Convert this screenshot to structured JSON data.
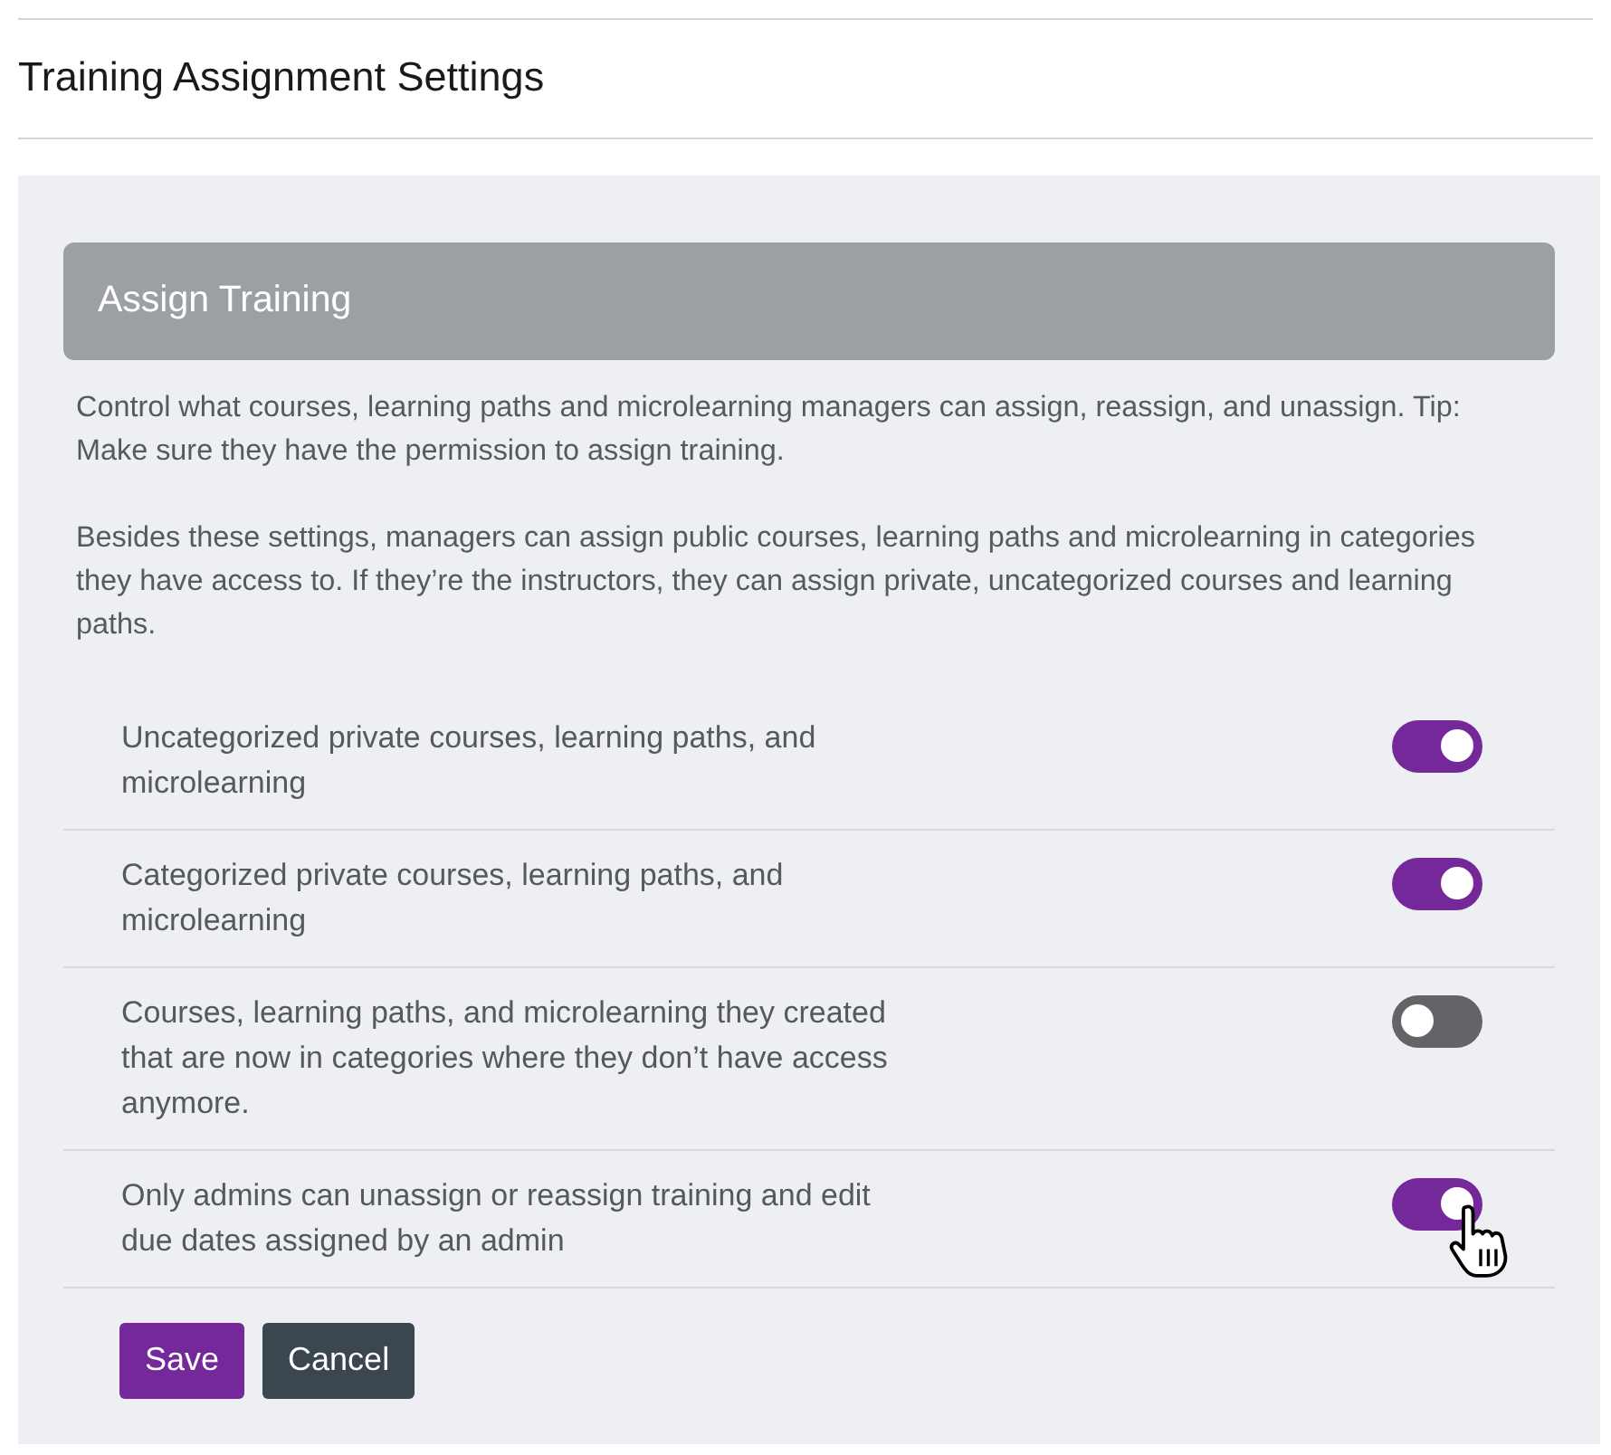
{
  "page": {
    "title": "Training Assignment Settings"
  },
  "panel": {
    "header": "Assign Training",
    "description": [
      "Control what courses, learning paths and microlearning managers can assign, reassign, and unassign. Tip: Make sure they have the permission to assign training.",
      "Besides these settings, managers can assign public courses, learning paths and microlearning in categories they have access to. If they’re the instructors, they can assign private, uncategorized courses and learning paths."
    ]
  },
  "settings": [
    {
      "label": "Uncategorized private courses, learning paths, and microlearning",
      "on": true
    },
    {
      "label": "Categorized private courses, learning paths, and microlearning",
      "on": true
    },
    {
      "label": "Courses, learning paths, and microlearning they created that are now in categories where they don’t have access anymore.",
      "on": false
    },
    {
      "label": "Only admins can unassign or reassign training and edit due dates assigned by an admin",
      "on": true
    }
  ],
  "buttons": [
    {
      "label": "Save",
      "kind": "primary"
    },
    {
      "label": "Cancel",
      "kind": "secondary"
    }
  ]
}
